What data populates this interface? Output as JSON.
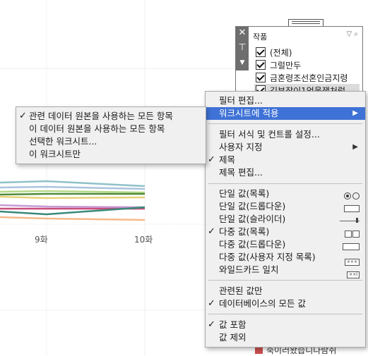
{
  "chart": {
    "x_ticks": [
      "9화",
      "10화"
    ],
    "series_colors": [
      "#8fc1c9",
      "#aac4de",
      "#b7d98b",
      "#4f8c3a",
      "#e8d27a",
      "#c79ad6",
      "#c94d7a",
      "#3a8a7a",
      "#f5b88a"
    ]
  },
  "filter_card": {
    "title": "작품",
    "items": [
      {
        "label": "(전체)",
        "checked": true
      },
      {
        "label": "그럴만두",
        "checked": true
      },
      {
        "label": "금혼령조선혼인금지령",
        "checked": true
      },
      {
        "label": "김부장이1억울잼처럼",
        "checked": true
      }
    ],
    "legend_item": "죽이러왔습니다람쥐",
    "legend_color": "#cc4f4f"
  },
  "context_menu": {
    "items": [
      {
        "label": "필터 편집...",
        "checked": false
      },
      {
        "label": "워크시트에 적용",
        "checked": false,
        "submenu": true,
        "highlighted": true
      },
      {
        "label": "필터 서식 및 컨트롤 설정...",
        "checked": false
      },
      {
        "label": "사용자 지정",
        "checked": false,
        "submenu": true
      },
      {
        "label": "제목",
        "checked": true
      },
      {
        "label": "제목 편집...",
        "checked": false
      },
      {
        "label": "단일 값(목록)",
        "checked": false,
        "icon": "radio-list-icon"
      },
      {
        "label": "단일 값(드롭다운)",
        "checked": false,
        "icon": "dropdown-icon"
      },
      {
        "label": "단일 값(슬라이더)",
        "checked": false,
        "icon": "slider-icon"
      },
      {
        "label": "다중 값(목록)",
        "checked": true,
        "icon": "checkbox-list-icon"
      },
      {
        "label": "다중 값(드롭다운)",
        "checked": false,
        "icon": "multi-dropdown-icon"
      },
      {
        "label": "다중 값(사용자 지정 목록)",
        "checked": false,
        "icon": "custom-list-icon"
      },
      {
        "label": "와일드카드 일치",
        "checked": false,
        "icon": "wildcard-icon"
      },
      {
        "label": "관련된 값만",
        "checked": false
      },
      {
        "label": "데이터베이스의 모든 값",
        "checked": true
      },
      {
        "label": "값 포함",
        "checked": true
      },
      {
        "label": "값 제외",
        "checked": false
      }
    ],
    "check_glyph": "✓",
    "submenu_glyph": "▶"
  },
  "submenu": {
    "items": [
      {
        "label": "관련 데이터 원본을 사용하는 모든 항목",
        "checked": true
      },
      {
        "label": "이 데이터 원본을 사용하는 모든 항목",
        "checked": false
      },
      {
        "label": "선택한 워크시트...",
        "checked": false
      },
      {
        "label": "이 워크시트만",
        "checked": false
      }
    ]
  }
}
